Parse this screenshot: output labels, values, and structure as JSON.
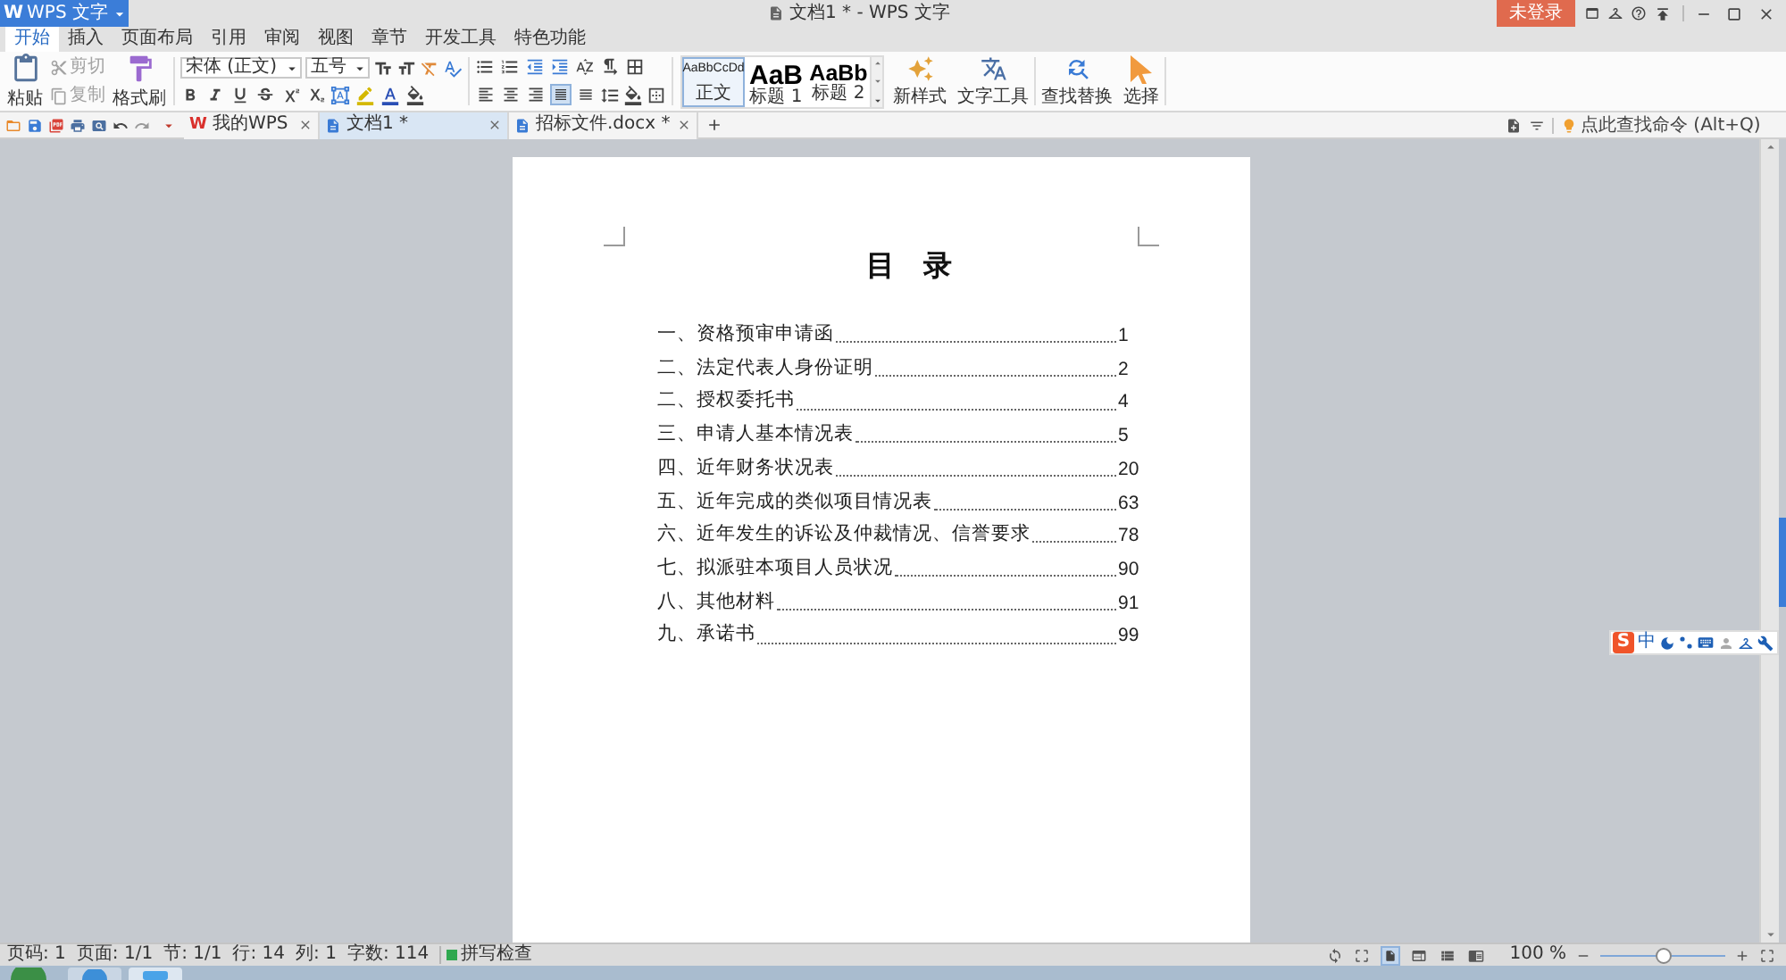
{
  "title_bar": {
    "app_logo": "W",
    "app_menu": "WPS 文字",
    "document_title": "文档1 * - WPS 文字",
    "login_button": "未登录"
  },
  "ribbon_tabs": [
    {
      "label": "开始",
      "selected": true
    },
    {
      "label": "插入",
      "selected": false
    },
    {
      "label": "页面布局",
      "selected": false
    },
    {
      "label": "引用",
      "selected": false
    },
    {
      "label": "审阅",
      "selected": false
    },
    {
      "label": "视图",
      "selected": false
    },
    {
      "label": "章节",
      "selected": false
    },
    {
      "label": "开发工具",
      "selected": false
    },
    {
      "label": "特色功能",
      "selected": false
    }
  ],
  "clipboard": {
    "paste": "粘贴",
    "cut": {
      "label": "剪切",
      "disabled": true
    },
    "copy": {
      "label": "复制",
      "disabled": true
    },
    "format_painter": "格式刷"
  },
  "font": {
    "name": "宋体 (正文)",
    "size": "五号"
  },
  "alignment_buttons": [
    {
      "kind": "left",
      "selected": false
    },
    {
      "kind": "center",
      "selected": false
    },
    {
      "kind": "right",
      "selected": false
    },
    {
      "kind": "justify",
      "selected": true
    },
    {
      "kind": "distributed",
      "selected": false
    }
  ],
  "styles": [
    {
      "preview": "AaBbCcDd",
      "label": "正文",
      "kind": "body",
      "selected": true
    },
    {
      "preview": "AaB",
      "label": "标题 1",
      "kind": "heading1",
      "selected": false
    },
    {
      "preview": "AaBb",
      "label": "标题 2",
      "kind": "heading2",
      "selected": false
    }
  ],
  "tools": [
    {
      "label": "新样式",
      "kind": "new_style"
    },
    {
      "label": "文字工具",
      "kind": "text_tools"
    },
    {
      "label": "查找替换",
      "kind": "find_replace"
    },
    {
      "label": "选择",
      "kind": "select"
    }
  ],
  "document_tabs": [
    {
      "label": "我的WPS",
      "kind": "home",
      "logo": "W",
      "selected": false
    },
    {
      "label": "文档1 *",
      "kind": "doc",
      "selected": true
    },
    {
      "label": "招标文件.docx *",
      "kind": "doc",
      "selected": false
    }
  ],
  "command_search": {
    "placeholder": "点此查找命令 (Alt+Q)"
  },
  "document": {
    "heading": "目　录",
    "toc": [
      {
        "title": "一、资格预审申请函",
        "page": "1"
      },
      {
        "title": "二、法定代表人身份证明",
        "page": "2"
      },
      {
        "title": "二、授权委托书",
        "page": "4"
      },
      {
        "title": "三、申请人基本情况表",
        "page": "5"
      },
      {
        "title": "四、近年财务状况表",
        "page": "20"
      },
      {
        "title": "五、近年完成的类似项目情况表",
        "page": "63"
      },
      {
        "title": "六、近年发生的诉讼及仲裁情况、信誉要求",
        "page": "78"
      },
      {
        "title": "七、拟派驻本项目人员状况",
        "page": "90"
      },
      {
        "title": "八、其他材料",
        "page": "91"
      },
      {
        "title": "九、承诺书",
        "page": "99"
      }
    ]
  },
  "ime_toolbar": {
    "logo": "S",
    "mode": "中"
  },
  "status_bar": {
    "fields": [
      "页码: 1",
      "页面: 1/1",
      "节: 1/1",
      "行: 14",
      "列: 1",
      "字数: 114"
    ],
    "spell_check": {
      "label": "拼写检查",
      "on": true
    },
    "view_modes": [
      {
        "kind": "full_screen",
        "selected": false
      },
      {
        "kind": "page",
        "selected": true
      },
      {
        "kind": "web",
        "selected": false
      },
      {
        "kind": "outline",
        "selected": false
      },
      {
        "kind": "reading",
        "selected": false
      }
    ],
    "zoom": {
      "reading": "100 %",
      "level": 0.5
    }
  }
}
